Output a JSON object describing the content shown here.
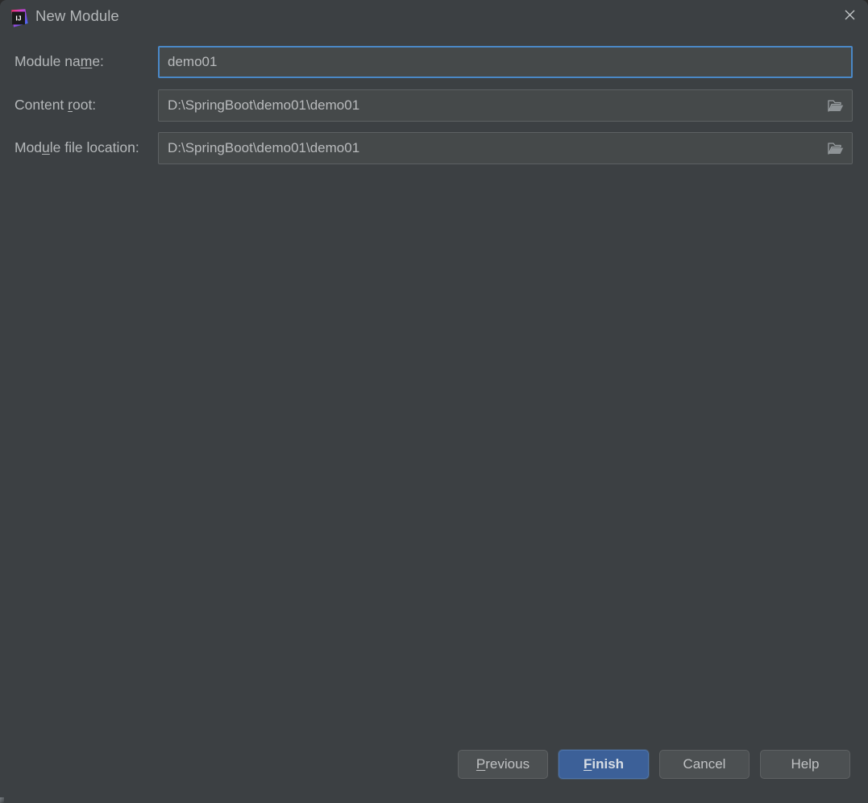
{
  "window": {
    "title": "New Module",
    "app_icon": "intellij-idea-icon",
    "close_label": "✕",
    "background_color": "#3c4043",
    "accent_color": "#4a88c7",
    "primary_button_color": "#3c6098"
  },
  "form": {
    "rows": [
      {
        "label_before": "Module na",
        "label_mnemonic": "m",
        "label_after": "e:",
        "name": "module-name",
        "value": "demo01",
        "focused": true,
        "has_browse": false
      },
      {
        "label_before": "Content ",
        "label_mnemonic": "r",
        "label_after": "oot:",
        "name": "content-root",
        "value": "D:\\SpringBoot\\demo01\\demo01",
        "focused": false,
        "has_browse": true,
        "browse_icon": "folder-icon"
      },
      {
        "label_before": "Mod",
        "label_mnemonic": "u",
        "label_after": "le file location:",
        "name": "module-file-location",
        "value": "D:\\SpringBoot\\demo01\\demo01",
        "focused": false,
        "has_browse": true,
        "browse_icon": "folder-icon"
      }
    ]
  },
  "footer": {
    "buttons": [
      {
        "name": "previous",
        "before": "",
        "mnemonic": "P",
        "after": "revious",
        "primary": false
      },
      {
        "name": "finish",
        "before": "",
        "mnemonic": "F",
        "after": "inish",
        "primary": true
      },
      {
        "name": "cancel",
        "before": "Cancel",
        "mnemonic": "",
        "after": "",
        "primary": false
      },
      {
        "name": "help",
        "before": "Help",
        "mnemonic": "",
        "after": "",
        "primary": false
      }
    ]
  }
}
